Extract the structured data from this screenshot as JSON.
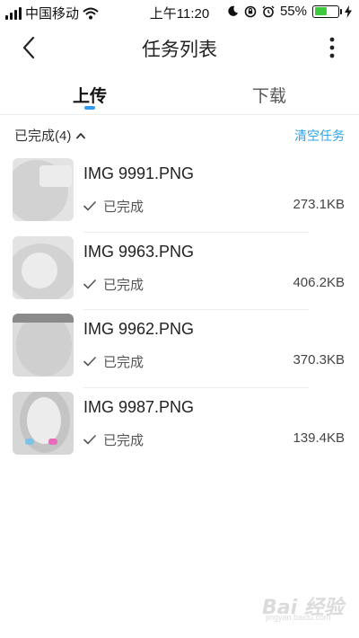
{
  "status_bar": {
    "carrier": "中国移动",
    "time": "上午11:20",
    "battery_percent": "55%",
    "battery_level": 0.55,
    "battery_color": "#3ec93e"
  },
  "nav": {
    "title": "任务列表",
    "back_icon": "chevron-left-icon",
    "more_icon": "more-vertical-icon"
  },
  "tabs": {
    "upload_label": "上传",
    "download_label": "下载",
    "active": "upload",
    "accent_color": "#2f9cf0"
  },
  "section": {
    "title": "已完成(4)",
    "clear_label": "清空任务",
    "clear_color": "#2fa3e6"
  },
  "tasks": [
    {
      "name": "IMG 9991.PNG",
      "status": "已完成",
      "size": "273.1KB"
    },
    {
      "name": "IMG 9963.PNG",
      "status": "已完成",
      "size": "406.2KB"
    },
    {
      "name": "IMG 9962.PNG",
      "status": "已完成",
      "size": "370.3KB"
    },
    {
      "name": "IMG 9987.PNG",
      "status": "已完成",
      "size": "139.4KB"
    }
  ],
  "watermark": {
    "text": "Bai 经验",
    "sub": "jingyan.baidu.com"
  }
}
